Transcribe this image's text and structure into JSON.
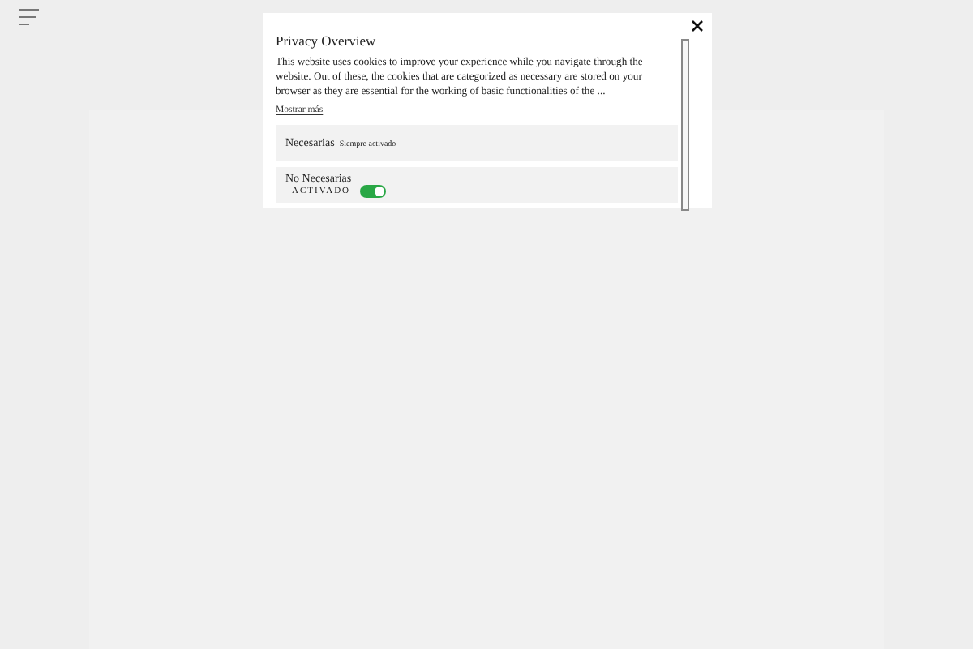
{
  "modal": {
    "title": "Privacy Overview",
    "body": "This website uses cookies to improve your experience while you navigate through the website. Out of these, the cookies that are categorized as necessary are stored on your browser as they are essential for the working of basic functionalities of the ...",
    "more_link": "Mostrar más",
    "categories": [
      {
        "kind": "always",
        "name": "Necesarias",
        "status": "Siempre activado"
      },
      {
        "kind": "toggle",
        "name": "No Necesarias",
        "toggle_label": "ACTIVADO",
        "on": true
      }
    ]
  }
}
